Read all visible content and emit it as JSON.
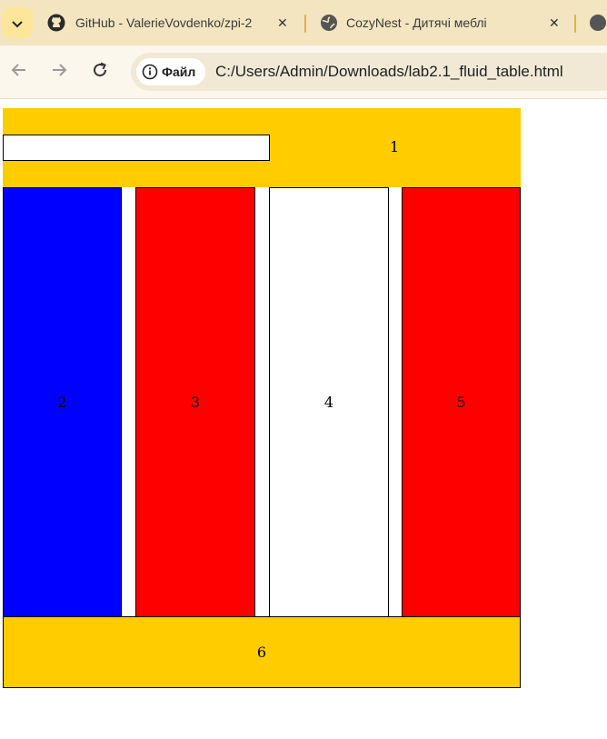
{
  "browser": {
    "tabs": [
      {
        "title": "GitHub - ValerieVovdenko/zpi-2",
        "icon": "github-icon",
        "active": false
      },
      {
        "title": "CozyNest - Дитячі меблі",
        "icon": "globe-icon",
        "active": false
      }
    ],
    "address": {
      "security_label": "Файл",
      "url": "C:/Users/Admin/Downloads/lab2.1_fluid_table.html"
    }
  },
  "page": {
    "header": {
      "label": "1",
      "color": "#ffcc00",
      "input_value": ""
    },
    "columns": [
      {
        "label": "2",
        "color": "#0000ff"
      },
      {
        "label": "3",
        "color": "#ff0000"
      },
      {
        "label": "4",
        "color": "#ffffff"
      },
      {
        "label": "5",
        "color": "#ff0000"
      }
    ],
    "footer": {
      "label": "6",
      "color": "#ffcc00"
    }
  }
}
